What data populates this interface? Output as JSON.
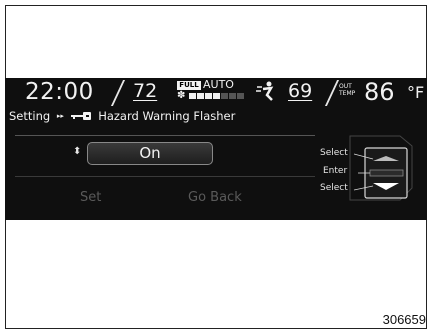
{
  "header": {
    "clock": "22:00",
    "left_temp": "72",
    "fan_badge": "FULL",
    "mode": "AUTO",
    "fan_level": 0.5,
    "right_temp": "69",
    "outside_label_line1": "OUT",
    "outside_label_line2": "TEMP",
    "outside_temp": "86",
    "outside_unit": "°F"
  },
  "breadcrumb": {
    "root": "Setting",
    "separator": "▸▸",
    "item": "Hazard Warning Flasher"
  },
  "setting": {
    "value": "On"
  },
  "buttons": {
    "set": "Set",
    "go_back": "Go Back"
  },
  "controls": {
    "select_up": "Select",
    "enter": "Enter",
    "select_down": "Select"
  },
  "figure_id": "306659",
  "colors": {
    "display_bg": "#0f0f0f",
    "text": "#f2f2f2",
    "disabled_text": "#5a5a5a"
  }
}
